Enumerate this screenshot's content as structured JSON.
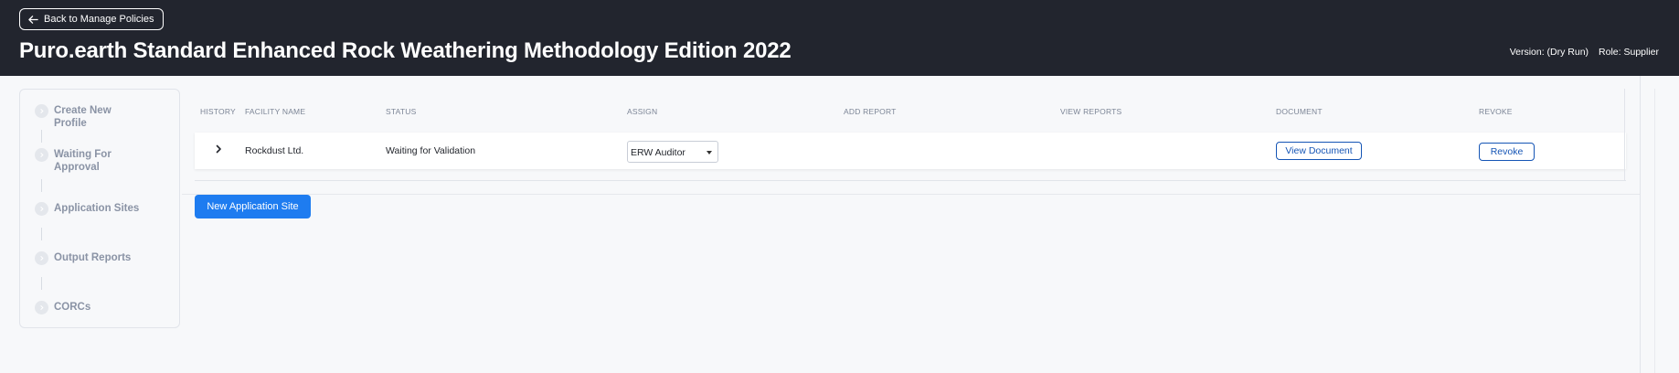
{
  "header": {
    "back_label": "Back to Manage Policies",
    "title": "Puro.earth Standard Enhanced Rock Weathering Methodology Edition 2022",
    "version": "Version: (Dry Run)",
    "role": "Role: Supplier"
  },
  "sidebar": {
    "steps": [
      {
        "label": "Create New Profile"
      },
      {
        "label": "Waiting For Approval"
      },
      {
        "label": "Application Sites"
      },
      {
        "label": "Output Reports"
      },
      {
        "label": "CORCs"
      }
    ]
  },
  "table": {
    "columns": [
      "HISTORY",
      "FACILITY NAME",
      "STATUS",
      "ASSIGN",
      "ADD REPORT",
      "VIEW REPORTS",
      "DOCUMENT",
      "REVOKE"
    ],
    "rows": [
      {
        "facility_name": "Rockdust Ltd.",
        "status": "Waiting for Validation",
        "assign_value": "ERW Auditor",
        "document_label": "View Document",
        "revoke_label": "Revoke"
      }
    ]
  },
  "actions": {
    "new_site_label": "New Application Site"
  },
  "colors": {
    "header_bg": "#22252e",
    "primary": "#1e7cf0",
    "link_outline": "#1555b5"
  }
}
